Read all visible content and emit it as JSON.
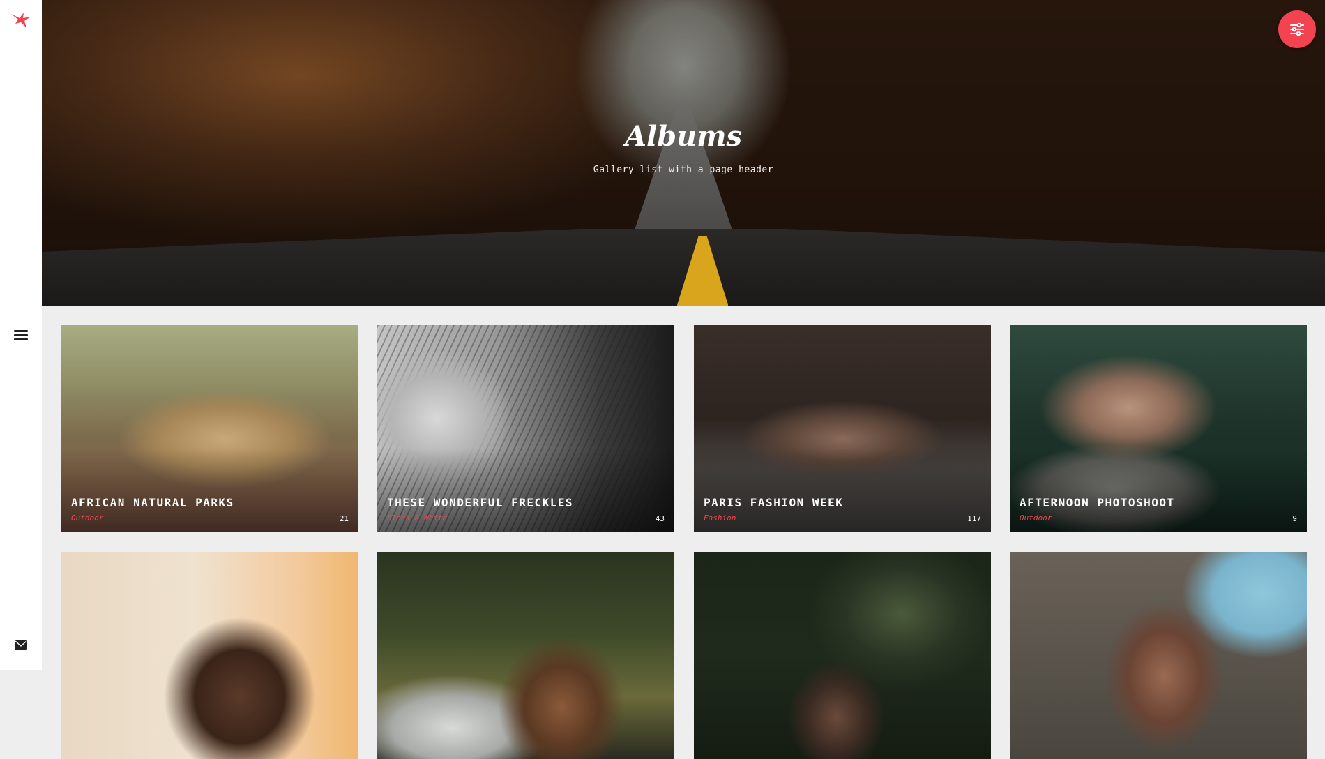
{
  "header": {
    "title": "Albums",
    "subtitle": "Gallery list with a page header"
  },
  "colors": {
    "accent": "#f44350",
    "sidebar": "#ffffff",
    "background": "#eeeeee"
  },
  "icons": {
    "logo": "bird-logo-icon",
    "menu": "hamburger-menu-icon",
    "mail": "envelope-icon",
    "settings": "sliders-icon"
  },
  "albums": [
    {
      "title": "AFRICAN NATURAL PARKS",
      "category": "Outdoor",
      "count": "21"
    },
    {
      "title": "THESE WONDERFUL FRECKLES",
      "category": "Black & White",
      "count": "43"
    },
    {
      "title": "PARIS FASHION WEEK",
      "category": "Fashion",
      "count": "117"
    },
    {
      "title": "AFTERNOON PHOTOSHOOT",
      "category": "Outdoor",
      "count": "9"
    },
    {
      "title": "",
      "category": "",
      "count": ""
    },
    {
      "title": "",
      "category": "",
      "count": ""
    },
    {
      "title": "",
      "category": "",
      "count": ""
    },
    {
      "title": "",
      "category": "",
      "count": ""
    }
  ]
}
